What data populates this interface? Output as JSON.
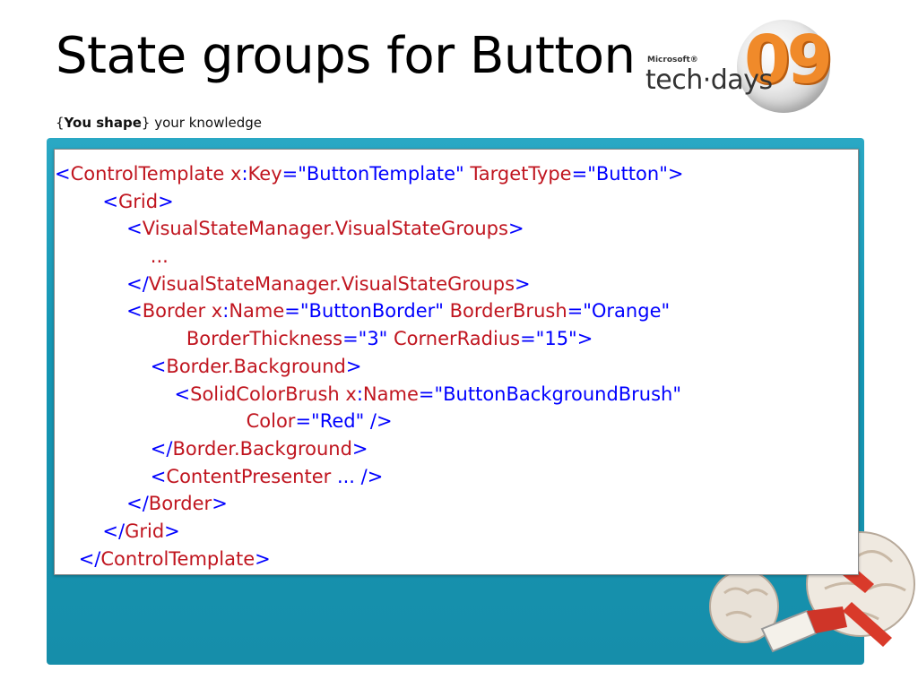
{
  "slide": {
    "title": "State groups for Button",
    "tagline": {
      "open": "{",
      "bold": "You shape",
      "close": "}",
      "rest": " your knowledge"
    }
  },
  "logo": {
    "small": "Microsoft®",
    "word": "tech·days",
    "number": "09"
  },
  "code": {
    "lines": [
      [
        [
          "b",
          "<"
        ],
        [
          "r",
          "ControlTemplate"
        ],
        [
          "b",
          " "
        ],
        [
          "r",
          "x"
        ],
        [
          "b",
          ":"
        ],
        [
          "r",
          "Key"
        ],
        [
          "b",
          "=\"ButtonTemplate\" "
        ],
        [
          "r",
          "TargetType"
        ],
        [
          "b",
          "=\"Button\">"
        ]
      ],
      [
        [
          "b",
          "        <"
        ],
        [
          "r",
          "Grid"
        ],
        [
          "b",
          ">"
        ]
      ],
      [
        [
          "b",
          "            <"
        ],
        [
          "r",
          "VisualStateManager.VisualStateGroups"
        ],
        [
          "b",
          ">"
        ]
      ],
      [
        [
          "r",
          "                ..."
        ]
      ],
      [
        [
          "b",
          "            </"
        ],
        [
          "r",
          "VisualStateManager.VisualStateGroups"
        ],
        [
          "b",
          ">"
        ]
      ],
      [
        [
          "b",
          "            <"
        ],
        [
          "r",
          "Border"
        ],
        [
          "b",
          " "
        ],
        [
          "r",
          "x"
        ],
        [
          "b",
          ":"
        ],
        [
          "r",
          "Name"
        ],
        [
          "b",
          "=\"ButtonBorder\" "
        ],
        [
          "r",
          "BorderBrush"
        ],
        [
          "b",
          "=\"Orange\""
        ]
      ],
      [
        [
          "r",
          "                      BorderThickness"
        ],
        [
          "b",
          "=\"3\" "
        ],
        [
          "r",
          "CornerRadius"
        ],
        [
          "b",
          "=\"15\">"
        ]
      ],
      [
        [
          "b",
          "                <"
        ],
        [
          "r",
          "Border.Background"
        ],
        [
          "b",
          ">"
        ]
      ],
      [
        [
          "b",
          "                    <"
        ],
        [
          "r",
          "SolidColorBrush"
        ],
        [
          "b",
          " "
        ],
        [
          "r",
          "x"
        ],
        [
          "b",
          ":"
        ],
        [
          "r",
          "Name"
        ],
        [
          "b",
          "=\"ButtonBackgroundBrush\""
        ]
      ],
      [
        [
          "r",
          "                                Color"
        ],
        [
          "b",
          "=\"Red\" />"
        ]
      ],
      [
        [
          "b",
          "                </"
        ],
        [
          "r",
          "Border.Background"
        ],
        [
          "b",
          ">"
        ]
      ],
      [
        [
          "b",
          "                <"
        ],
        [
          "r",
          "ContentPresenter"
        ],
        [
          "b",
          " ... />"
        ]
      ],
      [
        [
          "b",
          "            </"
        ],
        [
          "r",
          "Border"
        ],
        [
          "b",
          ">"
        ]
      ],
      [
        [
          "b",
          "        </"
        ],
        [
          "r",
          "Grid"
        ],
        [
          "b",
          ">"
        ]
      ],
      [
        [
          "b",
          "    </"
        ],
        [
          "r",
          "ControlTemplate"
        ],
        [
          "b",
          ">"
        ]
      ]
    ]
  },
  "colors": {
    "markup": "#0000ff",
    "name": "#c0151f",
    "panel": "#1a9ab8",
    "logo_accent": "#f08a2a"
  },
  "icons": {
    "mascot": "brain-mascot-icon"
  }
}
